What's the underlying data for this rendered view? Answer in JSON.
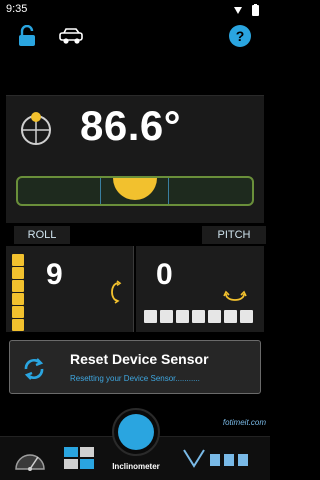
{
  "status": {
    "time": "9:35"
  },
  "header": {
    "lock_icon": "lock-open-icon",
    "car_icon": "car-icon",
    "help_icon": "help-icon",
    "accent": "#2aa5e0"
  },
  "main": {
    "angle": "86.6°",
    "level_bubble_position": 0.5
  },
  "tabs": {
    "roll": "ROLL",
    "pitch": "PITCH"
  },
  "roll": {
    "value": "9",
    "segments_filled": 6
  },
  "pitch": {
    "value": "0",
    "segments": 7
  },
  "reset": {
    "title": "Reset Device Sensor",
    "subtitle": "Resetting your Device Sensor..........."
  },
  "nav": {
    "items": [
      {
        "name": "protractor",
        "icon": "protractor-icon"
      },
      {
        "name": "sensor",
        "icon": "sensor-grid-icon"
      },
      {
        "name": "inclinometer",
        "label": "Inclinometer",
        "icon": "inclinometer-icon",
        "active": true
      }
    ]
  },
  "watermark": {
    "text": "fotimeit.com"
  }
}
